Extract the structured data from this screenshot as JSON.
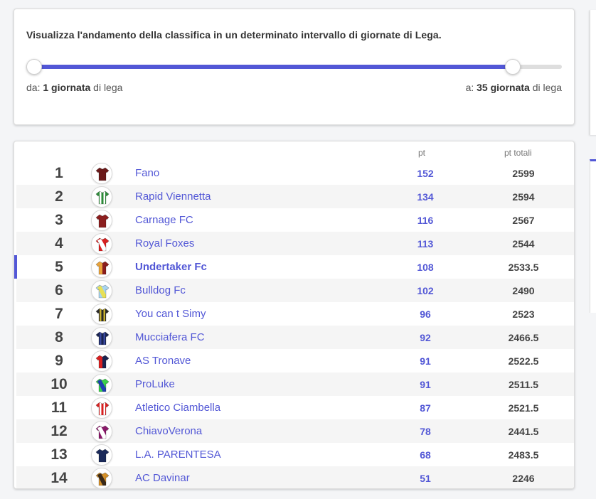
{
  "range": {
    "description": "Visualizza l'andamento della classifica in un determinato intervallo di giornate di Lega.",
    "from_prefix": "da:",
    "from_value": "1 giornata",
    "from_suffix": "di lega",
    "to_prefix": "a:",
    "to_value": "35 giornata",
    "to_suffix": "di lega",
    "slider_min_fraction": 0.0,
    "slider_max_fraction": 0.92
  },
  "standings": {
    "headers": {
      "pt": "pt",
      "pt_total": "pt totali"
    },
    "accent_color": "#5257d6",
    "highlight_rank": 5,
    "rows": [
      {
        "rank": "1",
        "team": "Fano",
        "pt": "152",
        "total": "2599",
        "jersey": {
          "primary": "#6b1a1a",
          "secondary": "#6b1a1a",
          "pattern": "solid"
        }
      },
      {
        "rank": "2",
        "team": "Rapid Viennetta",
        "pt": "134",
        "total": "2594",
        "jersey": {
          "primary": "#2e8b3a",
          "secondary": "#ffffff",
          "pattern": "stripes"
        }
      },
      {
        "rank": "3",
        "team": "Carnage FC",
        "pt": "116",
        "total": "2567",
        "jersey": {
          "primary": "#8b1e1e",
          "secondary": "#8b1e1e",
          "pattern": "solid"
        }
      },
      {
        "rank": "4",
        "team": "Royal Foxes",
        "pt": "113",
        "total": "2544",
        "jersey": {
          "primary": "#d92020",
          "secondary": "#ffffff",
          "pattern": "sash"
        }
      },
      {
        "rank": "5",
        "team": "Undertaker Fc",
        "pt": "108",
        "total": "2533.5",
        "jersey": {
          "primary": "#e8a33c",
          "secondary": "#8b1e1e",
          "pattern": "halves"
        }
      },
      {
        "rank": "6",
        "team": "Bulldog Fc",
        "pt": "102",
        "total": "2490",
        "jersey": {
          "primary": "#a8d4ef",
          "secondary": "#e8e055",
          "pattern": "sash"
        }
      },
      {
        "rank": "7",
        "team": "You can t Simy",
        "pt": "96",
        "total": "2523",
        "jersey": {
          "primary": "#2a2a2a",
          "secondary": "#c8b030",
          "pattern": "stripes"
        }
      },
      {
        "rank": "8",
        "team": "Mucciafera FC",
        "pt": "92",
        "total": "2466.5",
        "jersey": {
          "primary": "#1a2450",
          "secondary": "#3a4aa0",
          "pattern": "stripes"
        }
      },
      {
        "rank": "9",
        "team": "AS Tronave",
        "pt": "91",
        "total": "2522.5",
        "jersey": {
          "primary": "#d92020",
          "secondary": "#1a2450",
          "pattern": "halves"
        }
      },
      {
        "rank": "10",
        "team": "ProLuke",
        "pt": "91",
        "total": "2511.5",
        "jersey": {
          "primary": "#3bd04a",
          "secondary": "#2040b0",
          "pattern": "sash"
        }
      },
      {
        "rank": "11",
        "team": "Atletico Ciambella",
        "pt": "87",
        "total": "2521.5",
        "jersey": {
          "primary": "#d92020",
          "secondary": "#ffffff",
          "pattern": "stripes"
        }
      },
      {
        "rank": "12",
        "team": "ChiavoVerona",
        "pt": "78",
        "total": "2441.5",
        "jersey": {
          "primary": "#8a1a6a",
          "secondary": "#ffffff",
          "pattern": "sash"
        }
      },
      {
        "rank": "13",
        "team": "L.A. PARENTESA",
        "pt": "68",
        "total": "2483.5",
        "jersey": {
          "primary": "#1a2a5a",
          "secondary": "#1a2a5a",
          "pattern": "solid"
        }
      },
      {
        "rank": "14",
        "team": "AC Davinar",
        "pt": "51",
        "total": "2246",
        "jersey": {
          "primary": "#d4902a",
          "secondary": "#3a2a1a",
          "pattern": "sash"
        }
      }
    ]
  }
}
